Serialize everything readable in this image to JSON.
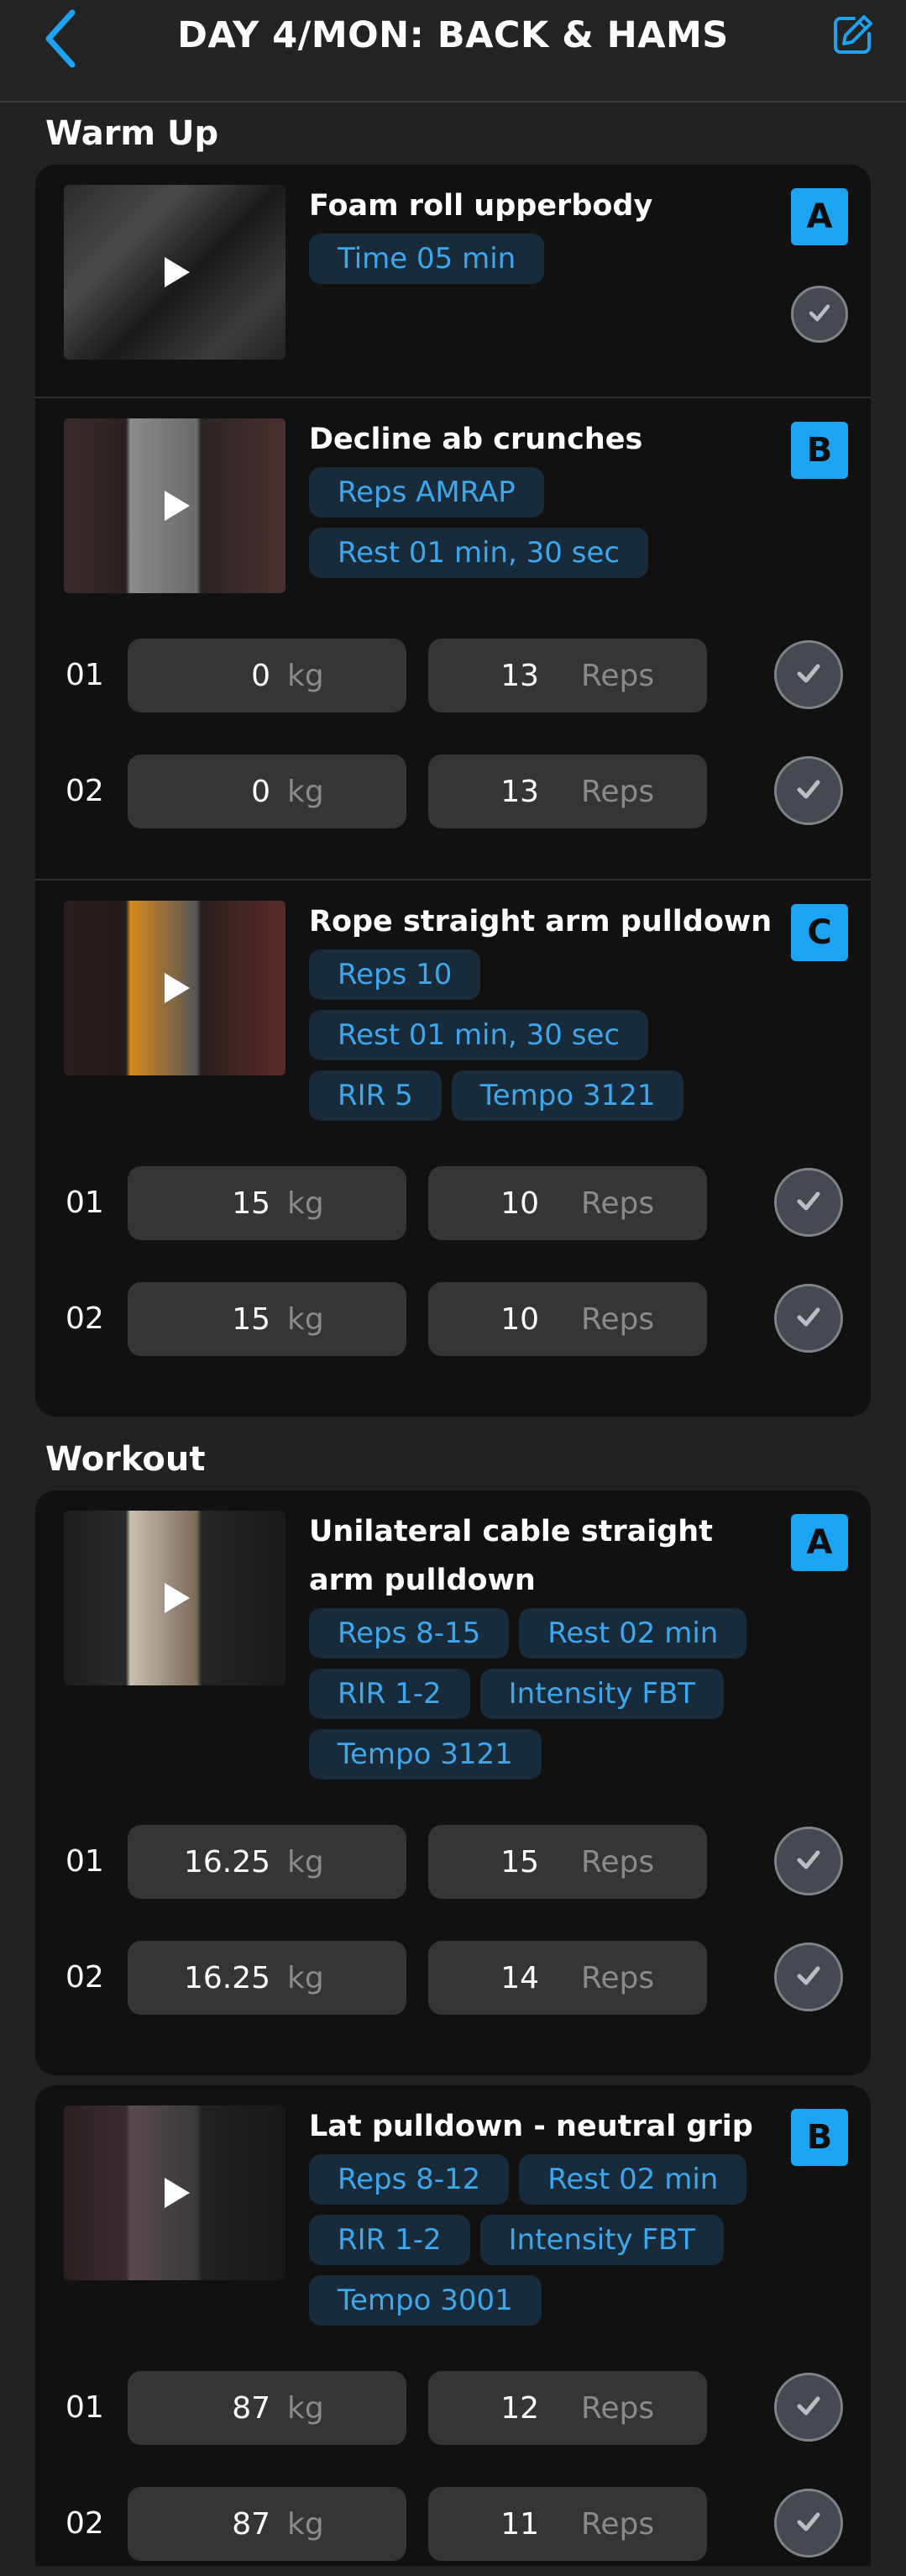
{
  "header": {
    "title": "DAY 4/MON: BACK & HAMS"
  },
  "colors": {
    "accent": "#1ca3f2",
    "tag_bg": "#182b3b",
    "tag_text": "#3ea6ea",
    "card_bg": "#111111",
    "field_bg": "#353535"
  },
  "sections": [
    {
      "title": "Warm Up",
      "exercises": [
        {
          "name": "Foam roll upperbody",
          "letter": "A",
          "tags": [
            "Time 05 min"
          ],
          "sets": []
        },
        {
          "name": "Decline ab crunches",
          "letter": "B",
          "tags": [
            "Reps AMRAP",
            "Rest 01 min, 30 sec"
          ],
          "sets": [
            {
              "num": "01",
              "weight": "0",
              "unit": "kg",
              "reps": "13",
              "reps_label": "Reps"
            },
            {
              "num": "02",
              "weight": "0",
              "unit": "kg",
              "reps": "13",
              "reps_label": "Reps"
            }
          ]
        },
        {
          "name": "Rope straight arm pulldown",
          "letter": "C",
          "tags": [
            "Reps 10",
            "Rest 01 min, 30 sec",
            "RIR 5",
            "Tempo 3121"
          ],
          "sets": [
            {
              "num": "01",
              "weight": "15",
              "unit": "kg",
              "reps": "10",
              "reps_label": "Reps"
            },
            {
              "num": "02",
              "weight": "15",
              "unit": "kg",
              "reps": "10",
              "reps_label": "Reps"
            }
          ]
        }
      ]
    },
    {
      "title": "Workout",
      "exercises": [
        {
          "name": "Unilateral cable straight arm pulldown",
          "letter": "A",
          "tags": [
            "Reps 8-15",
            "Rest 02 min",
            "RIR 1-2",
            "Intensity FBT",
            "Tempo 3121"
          ],
          "sets": [
            {
              "num": "01",
              "weight": "16.25",
              "unit": "kg",
              "reps": "15",
              "reps_label": "Reps"
            },
            {
              "num": "02",
              "weight": "16.25",
              "unit": "kg",
              "reps": "14",
              "reps_label": "Reps"
            }
          ]
        },
        {
          "name": "Lat pulldown - neutral grip",
          "letter": "B",
          "tags": [
            "Reps 8-12",
            "Rest 02 min",
            "RIR 1-2",
            "Intensity FBT",
            "Tempo 3001"
          ],
          "sets": [
            {
              "num": "01",
              "weight": "87",
              "unit": "kg",
              "reps": "12",
              "reps_label": "Reps"
            },
            {
              "num": "02",
              "weight": "87",
              "unit": "kg",
              "reps": "11",
              "reps_label": "Reps"
            }
          ]
        }
      ]
    }
  ]
}
